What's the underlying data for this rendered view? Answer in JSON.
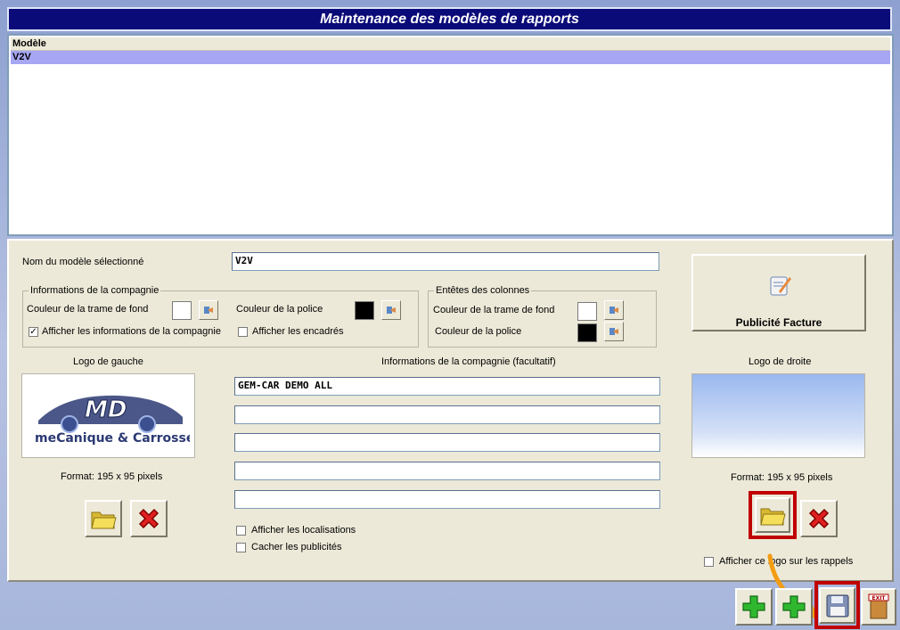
{
  "window": {
    "title": "Maintenance des modèles de rapports"
  },
  "list": {
    "column_header": "Modèle",
    "rows": [
      {
        "label": "V2V",
        "selected": true
      }
    ]
  },
  "form": {
    "model_name_label": "Nom du modèle sélectionné",
    "model_name_value": "V2V",
    "company_group": {
      "title": "Informations de la compagnie",
      "bg_color_label": "Couleur de la trame de fond",
      "bg_color": "#ffffff",
      "font_color_label": "Couleur de la police",
      "font_color": "#000000",
      "show_info_label": "Afficher les informations de la compagnie",
      "show_info_checked": true,
      "show_frames_label": "Afficher les encadrés",
      "show_frames_checked": false
    },
    "columns_group": {
      "title": "Entêtes des colonnes",
      "bg_color_label": "Couleur de la trame de fond",
      "bg_color": "#ffffff",
      "font_color_label": "Couleur de la police",
      "font_color": "#000000"
    },
    "ad_button_label": "Publicité Facture",
    "left_logo": {
      "title": "Logo de gauche",
      "format": "Format: 195 x 95 pixels",
      "logo_text_main": "MD",
      "logo_text_sub": "meCanique & Carrosserie"
    },
    "right_logo": {
      "title": "Logo de droite",
      "format": "Format: 195 x 95 pixels",
      "show_on_reminders_label": "Afficher ce logo sur les rappels",
      "show_on_reminders_checked": false
    },
    "company_info": {
      "title": "Informations de la compagnie (facultatif)",
      "lines": [
        "GEM-CAR DEMO ALL",
        "",
        "",
        "",
        ""
      ]
    },
    "show_locations_label": "Afficher les localisations",
    "show_locations_checked": false,
    "hide_ads_label": "Cacher les publicités",
    "hide_ads_checked": false
  },
  "toolbar": {
    "exit_label": "EXIT"
  },
  "colors": {
    "title_bg": "#0a0a78",
    "selected_row": "#a6a6f3",
    "panel_bg": "#ece9d8",
    "highlight": "#c00000",
    "arrow": "#f39c12"
  }
}
